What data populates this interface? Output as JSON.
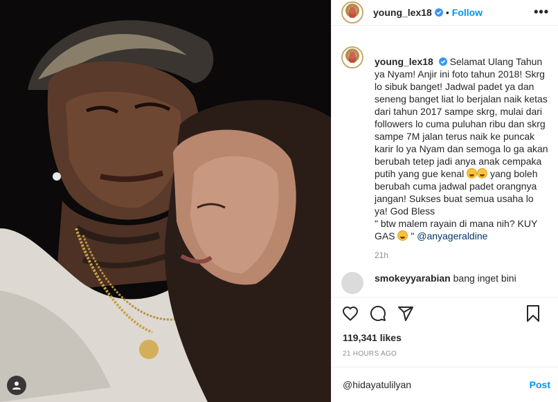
{
  "post": {
    "username": "young_lex18",
    "follow_label": "Follow",
    "header_separator": "•",
    "more_label": "•••",
    "caption": {
      "username": "young_lex18",
      "text_1": "Selamat Ulang Tahun ya Nyam! Anjir ini foto tahun 2018! Skrg lo sibuk banget! Jadwal padet ya dan seneng banget liat lo berjalan naik ketas dari tahun 2017 sampe skrg, mulai dari followers lo cuma puluhan ribu dan skrg sampe 7M jalan terus naik ke puncak karir lo ya Nyam dan semoga lo ga akan berubah tetep jadi anya anak cempaka putih yang gue kenal",
      "text_2": "yang boleh berubah cuma jadwal padet orangnya jangan! Sukses buat semua usaha lo ya! God Bless",
      "text_3": "\" btw malem rayain di mana nih? KUY GAS",
      "text_4": "\"",
      "mention": "@anyageraldine",
      "time": "21h"
    },
    "comment": {
      "username": "smokeyyarabian",
      "text": "bang inget bini"
    },
    "likes": "119,341 likes",
    "time_ago": "21 HOURS AGO",
    "comment_input_value": "@hidayatulilyan",
    "post_label": "Post",
    "icons": {
      "like": "heart-icon",
      "comment": "comment-icon",
      "share": "share-icon",
      "save": "bookmark-icon",
      "more": "more-options-icon",
      "verified": "verified-badge-icon",
      "tag": "user-tag-icon"
    },
    "colors": {
      "accent": "#0095f6",
      "text": "#262626",
      "muted": "#8e8e8e",
      "border": "#efefef",
      "verified": "#3897f0"
    }
  }
}
